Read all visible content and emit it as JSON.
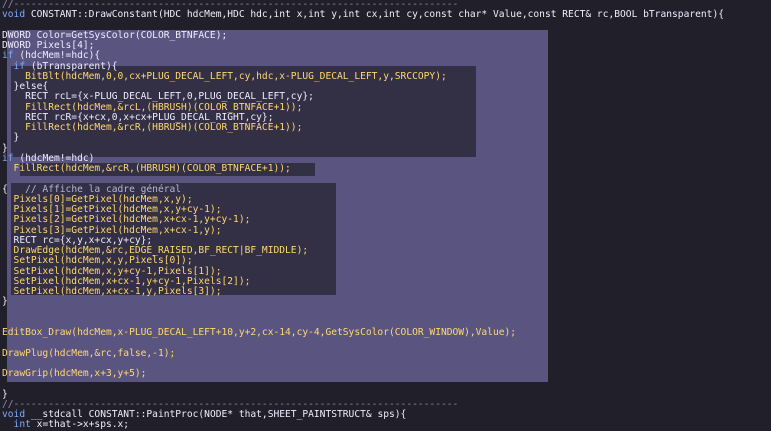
{
  "editor": {
    "lines": [
      {
        "tokens": [
          {
            "t": "//-----------------------------------------------------------------------------",
            "c": "sep"
          }
        ]
      },
      {
        "tokens": [
          {
            "t": "void",
            "c": "kw"
          },
          {
            "t": " CONSTANT::DrawConstant(HDC hdcMem,HDC hdc,int x,int y,int cx,int cy,const char* Value,const RECT& rc,BOOL bTransparent){",
            "c": "id"
          }
        ]
      },
      {
        "tokens": [
          {
            "t": "",
            "c": "id"
          }
        ]
      },
      {
        "tokens": [
          {
            "t": "DWORD Color=GetSysColor(COLOR_BTNFACE);",
            "c": "id"
          }
        ]
      },
      {
        "tokens": [
          {
            "t": "DWORD Pixels[4];",
            "c": "id"
          }
        ]
      },
      {
        "tokens": [
          {
            "t": "if",
            "c": "kw"
          },
          {
            "t": " (hdcMem!=hdc){",
            "c": "id"
          }
        ]
      },
      {
        "tokens": [
          {
            "t": "  if",
            "c": "kw"
          },
          {
            "t": " (bTransparent){",
            "c": "id"
          }
        ]
      },
      {
        "tokens": [
          {
            "t": "    BitBlt(hdcMem,0,0,cx+PLUG_DECAL_LEFT,cy,hdc,x-PLUG_DECAL_LEFT,y,SRCCOPY);",
            "c": "fn"
          }
        ]
      },
      {
        "tokens": [
          {
            "t": "  }else{",
            "c": "id"
          }
        ]
      },
      {
        "tokens": [
          {
            "t": "    RECT rcL={x-PLUG_DECAL_LEFT,0,PLUG_DECAL_LEFT,cy};",
            "c": "id"
          }
        ]
      },
      {
        "tokens": [
          {
            "t": "    FillRect(hdcMem,&rcL,(HBRUSH)(COLOR_BTNFACE+1));",
            "c": "fn"
          }
        ]
      },
      {
        "tokens": [
          {
            "t": "    RECT rcR={x+cx,0,x+cx+PLUG_DECAL_RIGHT,cy};",
            "c": "id"
          }
        ]
      },
      {
        "tokens": [
          {
            "t": "    FillRect(hdcMem,&rcR,(HBRUSH)(COLOR_BTNFACE+1));",
            "c": "fn"
          }
        ]
      },
      {
        "tokens": [
          {
            "t": "  }",
            "c": "id"
          }
        ]
      },
      {
        "tokens": [
          {
            "t": "}",
            "c": "id"
          }
        ]
      },
      {
        "tokens": [
          {
            "t": "if",
            "c": "kw"
          },
          {
            "t": " (hdcMem!=hdc)",
            "c": "id"
          }
        ]
      },
      {
        "tokens": [
          {
            "t": "  FillRect(hdcMem,&rcR,(HBRUSH)(COLOR_BTNFACE+1));",
            "c": "fn"
          }
        ]
      },
      {
        "tokens": [
          {
            "t": "",
            "c": "id"
          }
        ]
      },
      {
        "tokens": [
          {
            "t": "{   ",
            "c": "id"
          },
          {
            "t": "// Affiche la cadre général",
            "c": "cm"
          }
        ]
      },
      {
        "tokens": [
          {
            "t": "  Pixels[0]=GetPixel(hdcMem,x,y);",
            "c": "fn"
          }
        ]
      },
      {
        "tokens": [
          {
            "t": "  Pixels[1]=GetPixel(hdcMem,x,y+cy-1);",
            "c": "fn"
          }
        ]
      },
      {
        "tokens": [
          {
            "t": "  Pixels[2]=GetPixel(hdcMem,x+cx-1,y+cy-1);",
            "c": "fn"
          }
        ]
      },
      {
        "tokens": [
          {
            "t": "  Pixels[3]=GetPixel(hdcMem,x+cx-1,y);",
            "c": "fn"
          }
        ]
      },
      {
        "tokens": [
          {
            "t": "  RECT rc={x,y,x+cx,y+cy};",
            "c": "id"
          }
        ]
      },
      {
        "tokens": [
          {
            "t": "  DrawEdge(hdcMem,&rc,EDGE_RAISED,BF_RECT|BF_MIDDLE);",
            "c": "fn"
          }
        ]
      },
      {
        "tokens": [
          {
            "t": "  SetPixel(hdcMem,x,y,Pixels[0]);",
            "c": "fn"
          }
        ]
      },
      {
        "tokens": [
          {
            "t": "  SetPixel(hdcMem,x,y+cy-1,Pixels[1]);",
            "c": "fn"
          }
        ]
      },
      {
        "tokens": [
          {
            "t": "  SetPixel(hdcMem,x+cx-1,y+cy-1,Pixels[2]);",
            "c": "fn"
          }
        ]
      },
      {
        "tokens": [
          {
            "t": "  SetPixel(hdcMem,x+cx-1,y,Pixels[3]);",
            "c": "fn"
          }
        ]
      },
      {
        "tokens": [
          {
            "t": "}",
            "c": "id"
          }
        ]
      },
      {
        "tokens": [
          {
            "t": "",
            "c": "id"
          }
        ]
      },
      {
        "tokens": [
          {
            "t": "",
            "c": "id"
          }
        ]
      },
      {
        "tokens": [
          {
            "t": "EditBox_Draw(hdcMem,x-PLUG_DECAL_LEFT+10,y+2,cx-14,cy-4,GetSysColor(COLOR_WINDOW),Value);",
            "c": "fn"
          }
        ]
      },
      {
        "tokens": [
          {
            "t": "",
            "c": "id"
          }
        ]
      },
      {
        "tokens": [
          {
            "t": "DrawPlug(hdcMem,&rc,false,-1);",
            "c": "fn"
          }
        ]
      },
      {
        "tokens": [
          {
            "t": "",
            "c": "id"
          }
        ]
      },
      {
        "tokens": [
          {
            "t": "DrawGrip(hdcMem,x+3,y+5);",
            "c": "fn"
          }
        ]
      },
      {
        "tokens": [
          {
            "t": "",
            "c": "id"
          }
        ]
      },
      {
        "tokens": [
          {
            "t": "}",
            "c": "id"
          }
        ]
      },
      {
        "tokens": [
          {
            "t": "//-----------------------------------------------------------------------------",
            "c": "sep"
          }
        ]
      },
      {
        "tokens": [
          {
            "t": "void",
            "c": "kw"
          },
          {
            "t": " __stdcall CONSTANT::PaintProc(NODE* that,SHEET_PAINTSTRUCT& sps){",
            "c": "id"
          }
        ]
      },
      {
        "tokens": [
          {
            "t": "  int",
            "c": "kw"
          },
          {
            "t": " x=that->x+sps.x;",
            "c": "id"
          }
        ]
      }
    ]
  }
}
